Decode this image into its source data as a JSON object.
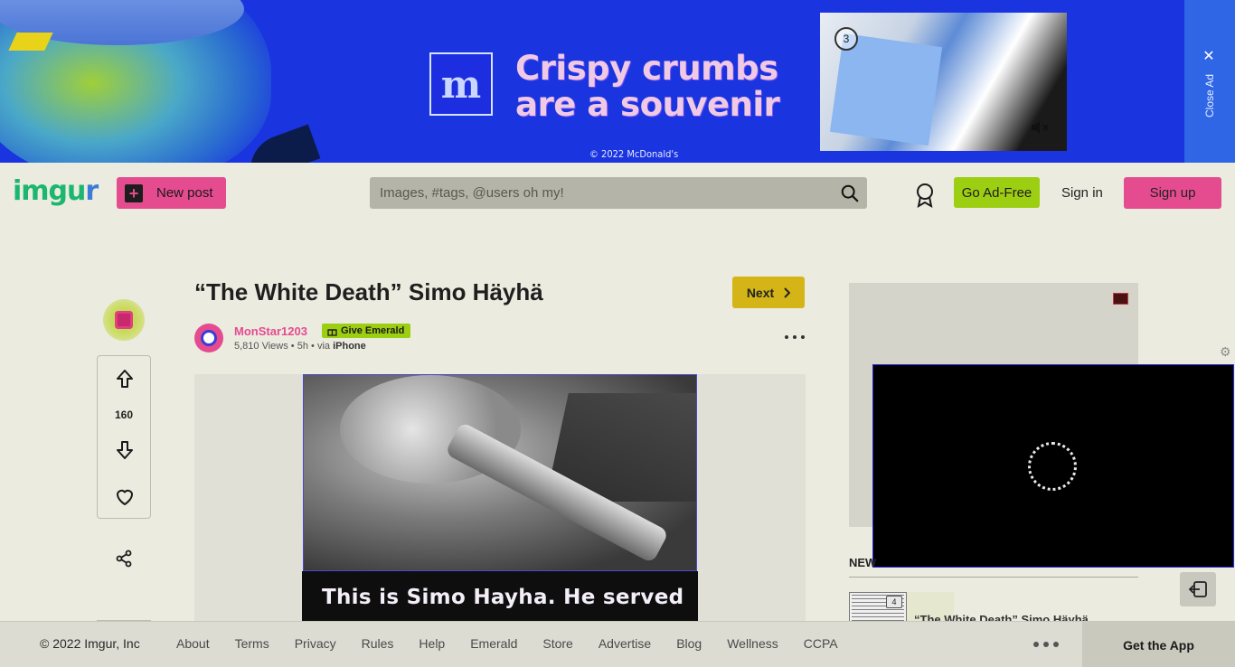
{
  "ad_banner": {
    "headline_line1": "Crispy crumbs",
    "headline_line2": "are a souvenir",
    "logo_letter": "m",
    "copyright": "© 2022 McDonald's",
    "video_countdown": "3",
    "close_label": "Close Ad",
    "close_glyph": "✕",
    "brand_color": "#1a34e0"
  },
  "header": {
    "logo_text_main": "imgu",
    "logo_text_end": "r",
    "new_post_label": "New post",
    "new_post_icon_glyph": "+",
    "search_placeholder": "Images, #tags, @users oh my!",
    "go_adfree_label": "Go Ad-Free",
    "sign_in_label": "Sign in",
    "sign_up_label": "Sign up",
    "icons": [
      "search-icon",
      "award-icon"
    ],
    "accent_pink": "#e54b8f",
    "accent_green": "#9cce12"
  },
  "post": {
    "title": "“The White Death” Simo Häyhä",
    "next_label": "Next",
    "username": "MonStar1203",
    "give_emerald_label": "Give Emerald",
    "views": "5,810 Views",
    "time": "5h",
    "via_prefix": "via",
    "via_device": "iPhone",
    "vote_count": "160",
    "subtitle": "This is Simo Hayha. He served"
  },
  "sidebar": {
    "new_label": "NEW",
    "next_thumb_count": "4",
    "next_post_title": "“The White Death” Simo Häyhä"
  },
  "footer": {
    "copyright": "© 2022 Imgur, Inc",
    "links": [
      "About",
      "Terms",
      "Privacy",
      "Rules",
      "Help",
      "Emerald",
      "Store",
      "Advertise",
      "Blog",
      "Wellness",
      "CCPA"
    ],
    "get_app_label": "Get the App"
  }
}
